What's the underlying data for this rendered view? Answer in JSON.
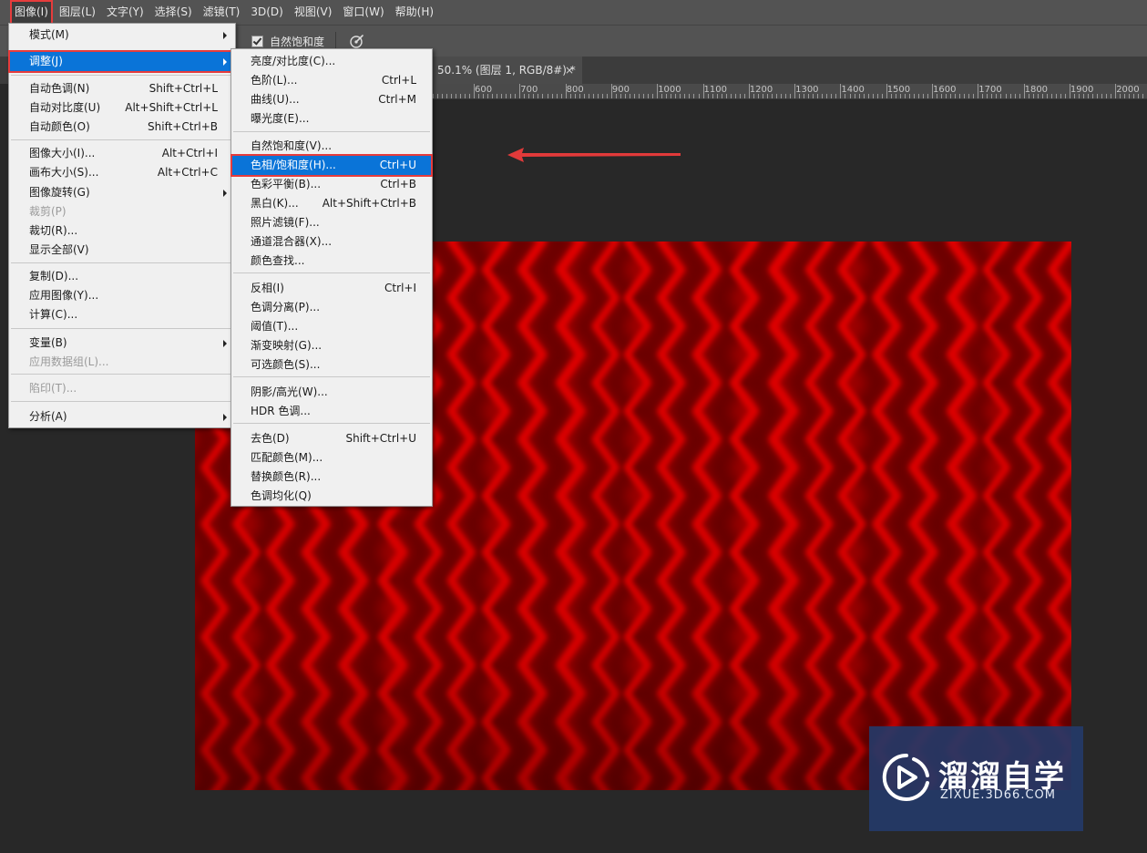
{
  "menubar": {
    "items": [
      "图像(I)",
      "图层(L)",
      "文字(Y)",
      "选择(S)",
      "滤镜(T)",
      "3D(D)",
      "视图(V)",
      "窗口(W)",
      "帮助(H)"
    ]
  },
  "options": {
    "vibrance_checkbox_label": "自然饱和度",
    "vibrance_checked": true
  },
  "document_tab": {
    "title": "50.1% (图层 1, RGB/8#) *",
    "close": "×"
  },
  "ruler": {
    "labels": [
      "600",
      "700",
      "800",
      "900",
      "1000",
      "1100",
      "1200",
      "1300",
      "1400",
      "1500",
      "1600",
      "1700",
      "1800",
      "1900",
      "2000"
    ]
  },
  "image_menu": {
    "items": [
      {
        "label": "模式(M)",
        "shortcut": "",
        "submenu": true,
        "disabled": false,
        "selected": false
      },
      {
        "label": "调整(J)",
        "shortcut": "",
        "submenu": true,
        "disabled": false,
        "selected": true
      },
      {
        "label": "自动色调(N)",
        "shortcut": "Shift+Ctrl+L",
        "submenu": false,
        "disabled": false,
        "selected": false
      },
      {
        "label": "自动对比度(U)",
        "shortcut": "Alt+Shift+Ctrl+L",
        "submenu": false,
        "disabled": false,
        "selected": false
      },
      {
        "label": "自动颜色(O)",
        "shortcut": "Shift+Ctrl+B",
        "submenu": false,
        "disabled": false,
        "selected": false
      },
      {
        "label": "图像大小(I)...",
        "shortcut": "Alt+Ctrl+I",
        "submenu": false,
        "disabled": false,
        "selected": false
      },
      {
        "label": "画布大小(S)...",
        "shortcut": "Alt+Ctrl+C",
        "submenu": false,
        "disabled": false,
        "selected": false
      },
      {
        "label": "图像旋转(G)",
        "shortcut": "",
        "submenu": true,
        "disabled": false,
        "selected": false
      },
      {
        "label": "裁剪(P)",
        "shortcut": "",
        "submenu": false,
        "disabled": true,
        "selected": false
      },
      {
        "label": "裁切(R)...",
        "shortcut": "",
        "submenu": false,
        "disabled": false,
        "selected": false
      },
      {
        "label": "显示全部(V)",
        "shortcut": "",
        "submenu": false,
        "disabled": false,
        "selected": false
      },
      {
        "label": "复制(D)...",
        "shortcut": "",
        "submenu": false,
        "disabled": false,
        "selected": false
      },
      {
        "label": "应用图像(Y)...",
        "shortcut": "",
        "submenu": false,
        "disabled": false,
        "selected": false
      },
      {
        "label": "计算(C)...",
        "shortcut": "",
        "submenu": false,
        "disabled": false,
        "selected": false
      },
      {
        "label": "变量(B)",
        "shortcut": "",
        "submenu": true,
        "disabled": false,
        "selected": false
      },
      {
        "label": "应用数据组(L)...",
        "shortcut": "",
        "submenu": false,
        "disabled": true,
        "selected": false
      },
      {
        "label": "陷印(T)...",
        "shortcut": "",
        "submenu": false,
        "disabled": true,
        "selected": false
      },
      {
        "label": "分析(A)",
        "shortcut": "",
        "submenu": true,
        "disabled": false,
        "selected": false
      }
    ]
  },
  "adjust_menu": {
    "items": [
      {
        "label": "亮度/对比度(C)...",
        "shortcut": "",
        "selected": false
      },
      {
        "label": "色阶(L)...",
        "shortcut": "Ctrl+L",
        "selected": false
      },
      {
        "label": "曲线(U)...",
        "shortcut": "Ctrl+M",
        "selected": false
      },
      {
        "label": "曝光度(E)...",
        "shortcut": "",
        "selected": false
      },
      {
        "label": "自然饱和度(V)...",
        "shortcut": "",
        "selected": false
      },
      {
        "label": "色相/饱和度(H)...",
        "shortcut": "Ctrl+U",
        "selected": true
      },
      {
        "label": "色彩平衡(B)...",
        "shortcut": "Ctrl+B",
        "selected": false
      },
      {
        "label": "黑白(K)...",
        "shortcut": "Alt+Shift+Ctrl+B",
        "selected": false
      },
      {
        "label": "照片滤镜(F)...",
        "shortcut": "",
        "selected": false
      },
      {
        "label": "通道混合器(X)...",
        "shortcut": "",
        "selected": false
      },
      {
        "label": "颜色查找...",
        "shortcut": "",
        "selected": false
      },
      {
        "label": "反相(I)",
        "shortcut": "Ctrl+I",
        "selected": false
      },
      {
        "label": "色调分离(P)...",
        "shortcut": "",
        "selected": false
      },
      {
        "label": "阈值(T)...",
        "shortcut": "",
        "selected": false
      },
      {
        "label": "渐变映射(G)...",
        "shortcut": "",
        "selected": false
      },
      {
        "label": "可选颜色(S)...",
        "shortcut": "",
        "selected": false
      },
      {
        "label": "阴影/高光(W)...",
        "shortcut": "",
        "selected": false
      },
      {
        "label": "HDR 色调...",
        "shortcut": "",
        "selected": false
      },
      {
        "label": "去色(D)",
        "shortcut": "Shift+Ctrl+U",
        "selected": false
      },
      {
        "label": "匹配颜色(M)...",
        "shortcut": "",
        "selected": false
      },
      {
        "label": "替换颜色(R)...",
        "shortcut": "",
        "selected": false
      },
      {
        "label": "色调均化(Q)",
        "shortcut": "",
        "selected": false
      }
    ]
  },
  "watermark": {
    "name": "溜溜自学",
    "url": "ZIXUE.3D66.COM"
  },
  "colors": {
    "menubar": "#535353",
    "workspace": "#282828",
    "menu_bg": "#f0f0f0",
    "selection": "#0a74d8",
    "highlight": "#e63c3c",
    "image_red": "#e00000",
    "image_dark": "#6a0000"
  }
}
